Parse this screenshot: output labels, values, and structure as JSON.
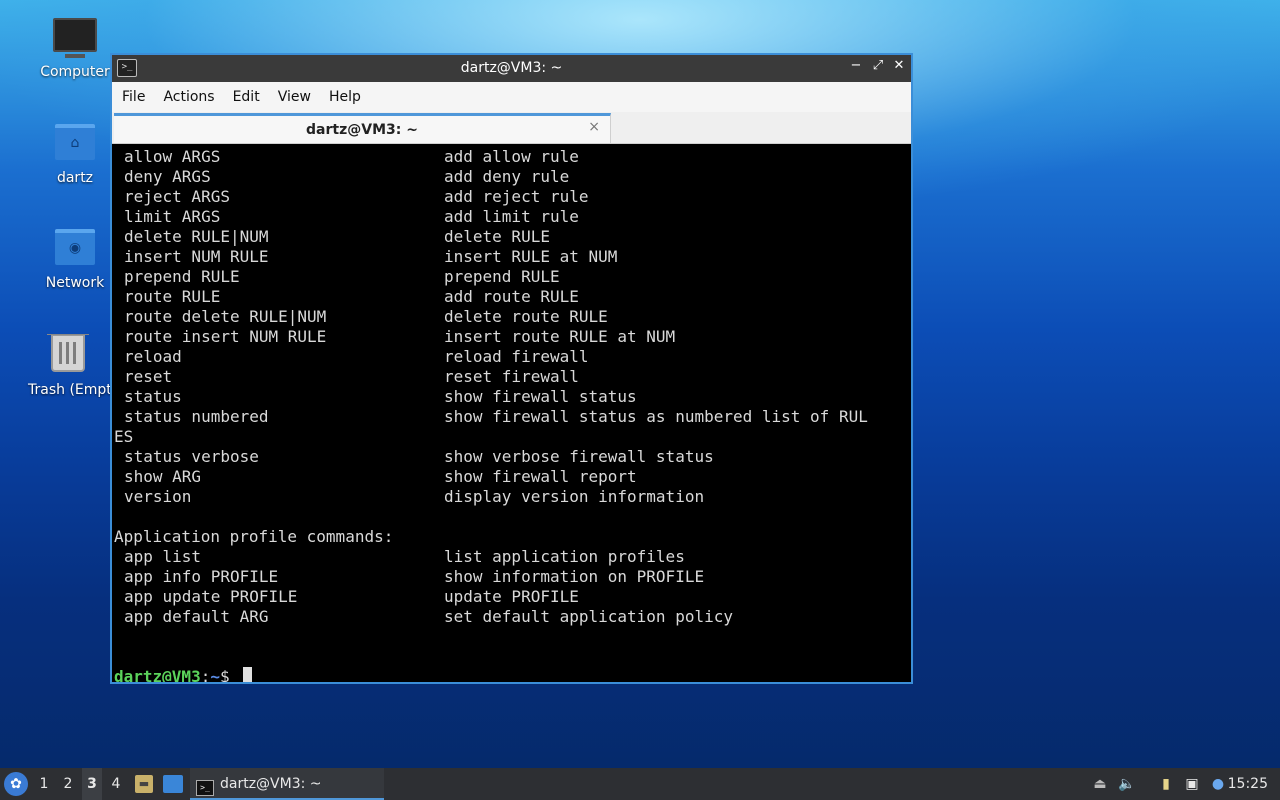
{
  "desktop": {
    "icons": [
      {
        "label": "Computer"
      },
      {
        "label": "dartz"
      },
      {
        "label": "Network"
      },
      {
        "label": "Trash (Empty)"
      }
    ]
  },
  "window": {
    "title": "dartz@VM3: ~",
    "controls": {
      "minimize": "−",
      "maximize": "⤢",
      "close": "✕"
    },
    "menu": [
      "File",
      "Actions",
      "Edit",
      "View",
      "Help"
    ],
    "tab": {
      "title": "dartz@VM3: ~",
      "close": "×"
    }
  },
  "terminal": {
    "commands": [
      {
        "cmd": "allow ARGS",
        "desc": "add allow rule"
      },
      {
        "cmd": "deny ARGS",
        "desc": "add deny rule"
      },
      {
        "cmd": "reject ARGS",
        "desc": "add reject rule"
      },
      {
        "cmd": "limit ARGS",
        "desc": "add limit rule"
      },
      {
        "cmd": "delete RULE|NUM",
        "desc": "delete RULE"
      },
      {
        "cmd": "insert NUM RULE",
        "desc": "insert RULE at NUM"
      },
      {
        "cmd": "prepend RULE",
        "desc": "prepend RULE"
      },
      {
        "cmd": "route RULE",
        "desc": "add route RULE"
      },
      {
        "cmd": "route delete RULE|NUM",
        "desc": "delete route RULE"
      },
      {
        "cmd": "route insert NUM RULE",
        "desc": "insert route RULE at NUM"
      },
      {
        "cmd": "reload",
        "desc": "reload firewall"
      },
      {
        "cmd": "reset",
        "desc": "reset firewall"
      },
      {
        "cmd": "status",
        "desc": "show firewall status"
      },
      {
        "cmd": "status numbered",
        "desc": "show firewall status as numbered list of RUL"
      }
    ],
    "wrap_line": "ES",
    "commands2": [
      {
        "cmd": "status verbose",
        "desc": "show verbose firewall status"
      },
      {
        "cmd": "show ARG",
        "desc": "show firewall report"
      },
      {
        "cmd": "version",
        "desc": "display version information"
      }
    ],
    "app_header": "Application profile commands:",
    "app_commands": [
      {
        "cmd": "app list",
        "desc": "list application profiles"
      },
      {
        "cmd": "app info PROFILE",
        "desc": "show information on PROFILE"
      },
      {
        "cmd": "app update PROFILE",
        "desc": "update PROFILE"
      },
      {
        "cmd": "app default ARG",
        "desc": "set default application policy"
      }
    ],
    "prompt": {
      "user": "dartz@VM3",
      "sep": ":",
      "path": "~",
      "symbol": "$ "
    }
  },
  "taskbar": {
    "workspaces": [
      "1",
      "2",
      "3",
      "4"
    ],
    "active_workspace": "3",
    "task_label": "dartz@VM3: ~",
    "clock": "15:25"
  }
}
